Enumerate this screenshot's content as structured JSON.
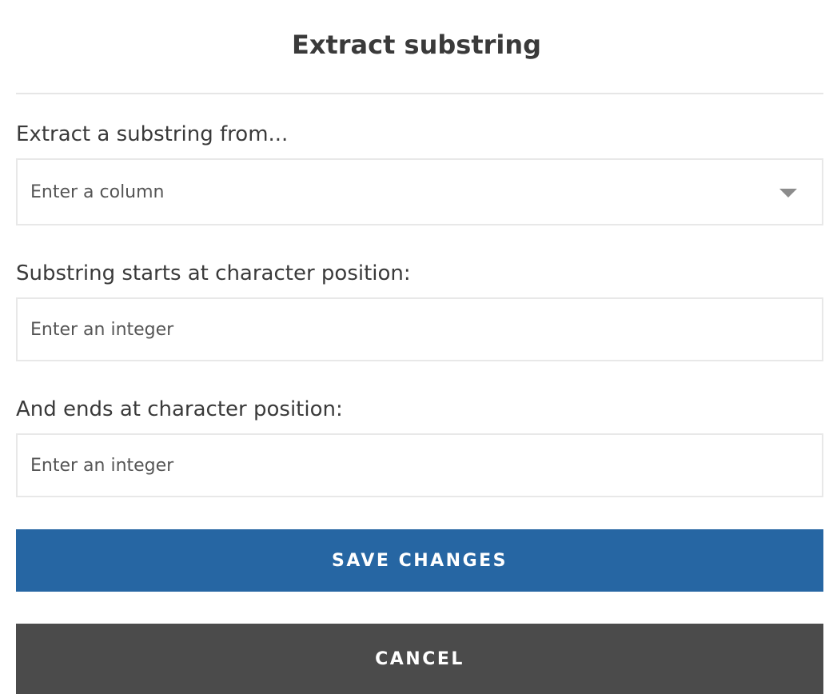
{
  "dialog": {
    "title": "Extract substring"
  },
  "fields": {
    "column": {
      "label": "Extract a substring from...",
      "placeholder": "Enter a column"
    },
    "start": {
      "label": "Substring starts at character position:",
      "placeholder": "Enter an integer"
    },
    "end": {
      "label": "And ends at character position:",
      "placeholder": "Enter an integer"
    }
  },
  "actions": {
    "save_label": "SAVE CHANGES",
    "cancel_label": "CANCEL"
  },
  "icons": {
    "dropdown": "chevron-down-icon"
  },
  "colors": {
    "primary": "#2666a3",
    "secondary": "#4b4b4b",
    "text": "#3a3a3a",
    "placeholder": "#555555",
    "border": "#e8e8e8"
  }
}
